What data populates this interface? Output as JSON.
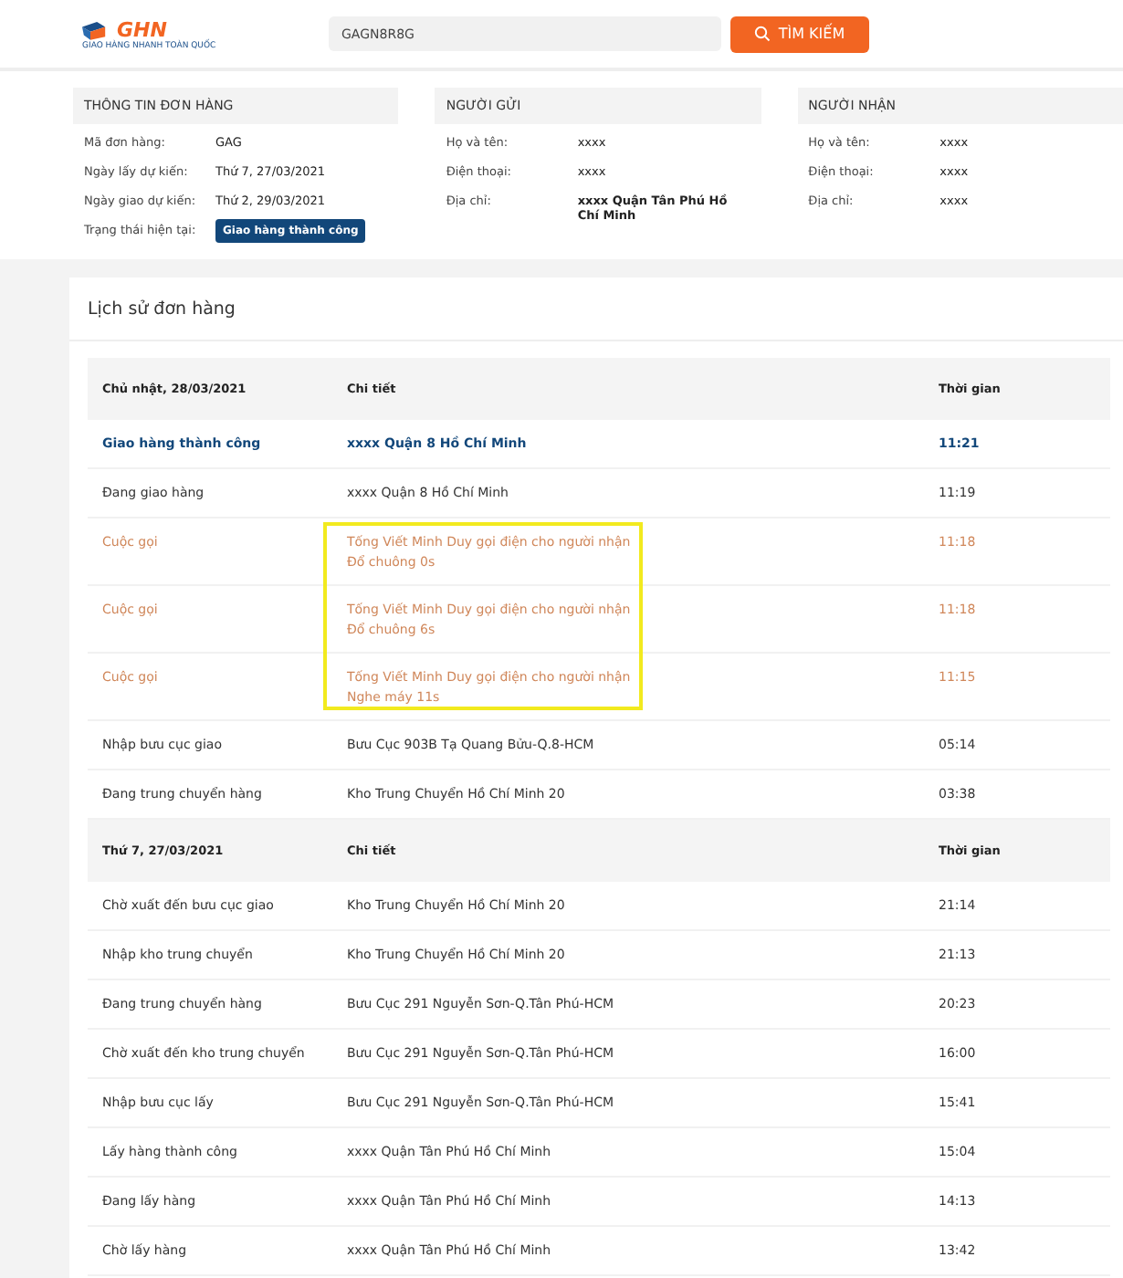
{
  "header": {
    "logo": "GHN",
    "tagline": "GIAO HÀNG NHANH TOÀN QUỐC",
    "search": {
      "value": "GAGN8R8G"
    },
    "search_button": "TÌM KIẾM"
  },
  "info_panels": [
    {
      "title": "THÔNG TIN ĐƠN HÀNG",
      "fields": [
        {
          "label": "Mã đơn hàng:",
          "value": "GAG"
        },
        {
          "label": "Ngày lấy dự kiến:",
          "value": "Thứ 7, 27/03/2021"
        },
        {
          "label": "Ngày giao dự kiến:",
          "value": "Thứ 2, 29/03/2021"
        },
        {
          "label": "Trạng thái hiện tại:",
          "value": "Giao hàng thành công",
          "kind": "badge"
        }
      ]
    },
    {
      "title": "NGƯỜI GỬI",
      "fields": [
        {
          "label": "Họ và tên:",
          "value": "xxxx"
        },
        {
          "label": "Điện thoại:",
          "value": "xxxx"
        },
        {
          "label": "Địa chỉ:",
          "value": "xxxx Quận Tân Phú Hồ Chí Minh",
          "kind": "bold"
        }
      ]
    },
    {
      "title": "NGƯỜI NHẬN",
      "fields": [
        {
          "label": "Họ và tên:",
          "value": "xxxx"
        },
        {
          "label": "Điện thoại:",
          "value": "xxxx"
        },
        {
          "label": "Địa chỉ:",
          "value": "xxxx"
        }
      ]
    }
  ],
  "history": {
    "title": "Lịch sử đơn hàng",
    "groups": [
      {
        "date": "Chủ nhật, 28/03/2021",
        "detail_heading": "Chi tiết",
        "time_heading": "Thời gian",
        "rows": [
          {
            "kind": "done",
            "status": "Giao hàng thành công",
            "detail": "xxxx Quận 8 Hồ Chí Minh",
            "time": "11:21",
            "highlighted": false
          },
          {
            "kind": "normal",
            "status": "Đang giao hàng",
            "detail": "xxxx Quận 8 Hồ Chí Minh",
            "time": "11:19",
            "highlighted": false
          },
          {
            "kind": "call",
            "status": "Cuộc gọi",
            "detail": "Tống Viết Minh Duy gọi điện cho người nhận",
            "detail_2": "Đổ chuông 0s",
            "time": "11:18",
            "highlighted": true
          },
          {
            "kind": "call",
            "status": "Cuộc gọi",
            "detail": "Tống Viết Minh Duy gọi điện cho người nhận",
            "detail_2": "Đổ chuông 6s",
            "time": "11:18",
            "highlighted": true
          },
          {
            "kind": "call",
            "status": "Cuộc gọi",
            "detail": "Tống Viết Minh Duy gọi điện cho người nhận",
            "detail_2": "Nghe máy 11s",
            "time": "11:15",
            "highlighted": true
          },
          {
            "kind": "normal",
            "status": "Nhập bưu cục giao",
            "detail": "Bưu Cục 903B Tạ Quang Bửu-Q.8-HCM",
            "time": "05:14",
            "highlighted": false
          },
          {
            "kind": "normal",
            "status": "Đang trung chuyển hàng",
            "detail": "Kho Trung Chuyển Hồ Chí Minh 20",
            "time": "03:38",
            "highlighted": false
          }
        ]
      },
      {
        "date": "Thứ 7, 27/03/2021",
        "detail_heading": "Chi tiết",
        "time_heading": "Thời gian",
        "rows": [
          {
            "kind": "normal",
            "status": "Chờ xuất đến bưu cục giao",
            "detail": "Kho Trung Chuyển Hồ Chí Minh 20",
            "time": "21:14",
            "highlighted": false
          },
          {
            "kind": "normal",
            "status": "Nhập kho trung chuyển",
            "detail": "Kho Trung Chuyển Hồ Chí Minh 20",
            "time": "21:13",
            "highlighted": false
          },
          {
            "kind": "normal",
            "status": "Đang trung chuyển hàng",
            "detail": "Bưu Cục 291 Nguyễn Sơn-Q.Tân Phú-HCM",
            "time": "20:23",
            "highlighted": false
          },
          {
            "kind": "normal",
            "status": "Chờ xuất đến kho trung chuyển",
            "detail": "Bưu Cục 291 Nguyễn Sơn-Q.Tân Phú-HCM",
            "time": "16:00",
            "highlighted": false
          },
          {
            "kind": "normal",
            "status": "Nhập bưu cục lấy",
            "detail": "Bưu Cục 291 Nguyễn Sơn-Q.Tân Phú-HCM",
            "time": "15:41",
            "highlighted": false
          },
          {
            "kind": "normal",
            "status": "Lấy hàng thành công",
            "detail": "xxxx Quận Tân Phú Hồ Chí Minh",
            "time": "15:04",
            "highlighted": false
          },
          {
            "kind": "normal",
            "status": "Đang lấy hàng",
            "detail": "xxxx Quận Tân Phú Hồ Chí Minh",
            "time": "14:13",
            "highlighted": false
          },
          {
            "kind": "normal",
            "status": "Chờ lấy hàng",
            "detail": "xxxx Quận Tân Phú Hồ Chí Minh",
            "time": "13:42",
            "highlighted": false
          }
        ]
      }
    ]
  }
}
